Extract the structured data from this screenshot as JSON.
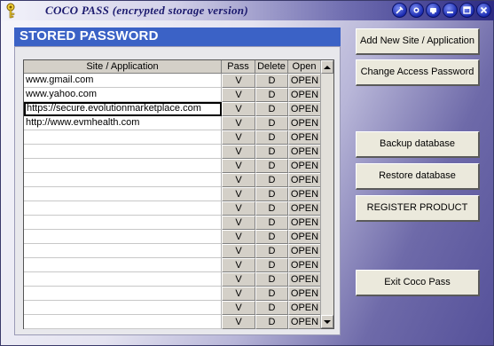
{
  "window": {
    "title": "COCO PASS (encrypted storage version)",
    "app_icon": "key-icon",
    "title_buttons": [
      "pin-icon",
      "help-icon",
      "info-icon",
      "minimize-icon",
      "maximize-icon",
      "close-icon"
    ]
  },
  "panel": {
    "header": "STORED PASSWORD",
    "columns": {
      "site": "Site / Application",
      "pass": "Pass",
      "delete": "Delete",
      "open": "Open"
    },
    "row_labels": {
      "pass": "V",
      "delete": "D",
      "open": "OPEN"
    },
    "sites": [
      "www.gmail.com",
      "www.yahoo.com",
      "https://secure.evolutionmarketplace.com",
      "http://www.evmhealth.com",
      "",
      "",
      "",
      "",
      "",
      "",
      "",
      "",
      "",
      "",
      "",
      "",
      "",
      ""
    ],
    "selected_row": 2
  },
  "actions": {
    "add_site": "Add New Site / Application",
    "change_password": "Change Access Password",
    "backup": "Backup database",
    "restore": "Restore database",
    "register": "REGISTER PRODUCT",
    "exit": "Exit Coco Pass"
  },
  "colors": {
    "header_bg": "#3b62c6",
    "title_text": "#1c1a6e"
  }
}
